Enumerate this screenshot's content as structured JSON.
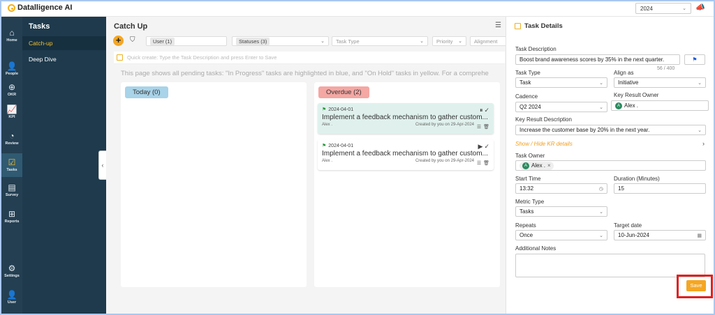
{
  "brand": {
    "name": "Datalligence AI",
    "accent": "#f5a623",
    "sidebar_bg": "#243f52"
  },
  "topbar": {
    "year": "2024"
  },
  "nav": {
    "items": [
      {
        "label": "Home",
        "icon": "home-icon"
      },
      {
        "label": "People",
        "icon": "people-icon"
      },
      {
        "label": "OKR",
        "icon": "target-icon"
      },
      {
        "label": "KPI",
        "icon": "chart-icon"
      },
      {
        "label": "Review",
        "icon": "gauge-icon"
      },
      {
        "label": "Tasks",
        "icon": "tasks-icon"
      },
      {
        "label": "Survey",
        "icon": "survey-icon"
      },
      {
        "label": "Reports",
        "icon": "reports-icon"
      },
      {
        "label": "Settings",
        "icon": "gear-icon"
      },
      {
        "label": "User",
        "icon": "user-icon"
      }
    ]
  },
  "tasks_panel": {
    "title": "Tasks",
    "items": [
      {
        "label": "Catch-up"
      },
      {
        "label": "Deep Dive"
      }
    ]
  },
  "main": {
    "title": "Catch Up",
    "filters": {
      "user": "User (1)",
      "statuses": "Statuses (3)",
      "task_type": "Task Type",
      "priority": "Priority",
      "alignment": "Alignment"
    },
    "quick_create": "Quick create: Type the Task Description and press Enter to Save",
    "note": "This page shows all pending tasks: \"In Progress\" tasks are highlighted in blue, and \"On Hold\" tasks in yellow. For a comprehe",
    "columns": [
      {
        "label": "Today (0)",
        "color": "#a8d3e8",
        "cards": []
      },
      {
        "label": "Overdue (2)",
        "color": "#f4a7a3",
        "cards": [
          {
            "date": "2024-04-01",
            "title": "Implement a feedback mechanism to gather custom...",
            "owner": "Alex .",
            "created": "Created by you on 29-Apr-2024",
            "bg": "#e0f1ed"
          },
          {
            "date": "2024-04-01",
            "title": "Implement a feedback mechanism to gather custom...",
            "owner": "Alex .",
            "created": "Created by you on 29-Apr-2024",
            "bg": "#ffffff"
          }
        ]
      }
    ]
  },
  "detail": {
    "header": "Task Details",
    "task_description_label": "Task Description",
    "task_description": "Boost brand awareness scores by 35% in the next quarter.",
    "counter": "56 / 400",
    "task_type_label": "Task Type",
    "task_type": "Task",
    "align_as_label": "Align as",
    "align_as": "Initiative",
    "cadence_label": "Cadence",
    "cadence": "Q2 2024",
    "kr_owner_label": "Key Result Owner",
    "kr_owner": "Alex .",
    "kr_desc_label": "Key Result Description",
    "kr_desc": "Increase the customer base by 20% in the next year.",
    "show_hide": "Show / Hide KR details",
    "task_owner_label": "Task Owner",
    "task_owner": "Alex .",
    "start_time_label": "Start Time",
    "start_time": "13:32",
    "duration_label": "Duration (Minutes)",
    "duration": "15",
    "metric_type_label": "Metric Type",
    "metric_type": "Tasks",
    "repeats_label": "Repeats",
    "repeats": "Once",
    "target_date_label": "Target date",
    "target_date": "10-Jun-2024",
    "notes_label": "Additional Notes",
    "save": "Save",
    "avatar_letter": "A"
  }
}
